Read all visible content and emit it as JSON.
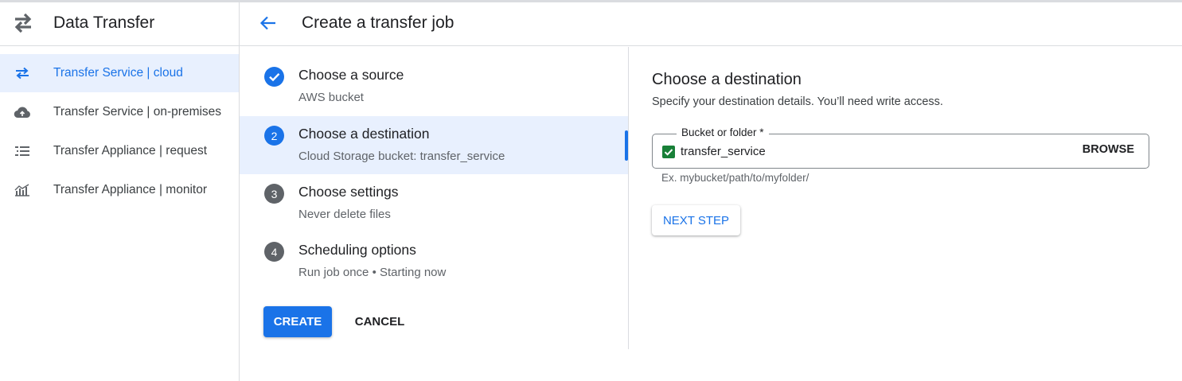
{
  "app": {
    "title": "Data Transfer"
  },
  "sidebar": {
    "items": [
      {
        "label": "Transfer Service | cloud",
        "icon": "swap-arrows-icon",
        "active": true
      },
      {
        "label": "Transfer Service | on-premises",
        "icon": "cloud-upload-icon"
      },
      {
        "label": "Transfer Appliance | request",
        "icon": "list-icon"
      },
      {
        "label": "Transfer Appliance | monitor",
        "icon": "monitoring-chart-icon"
      }
    ]
  },
  "header": {
    "title": "Create a transfer job",
    "back_icon": "arrow-back-icon"
  },
  "steps": [
    {
      "number": "1",
      "title": "Choose a source",
      "subtitle": "AWS bucket",
      "state": "complete"
    },
    {
      "number": "2",
      "title": "Choose a destination",
      "subtitle": "Cloud Storage bucket: transfer_service",
      "state": "active"
    },
    {
      "number": "3",
      "title": "Choose settings",
      "subtitle": "Never delete files",
      "state": "pending"
    },
    {
      "number": "4",
      "title": "Scheduling options",
      "subtitle": "Run job once • Starting now",
      "state": "pending"
    }
  ],
  "actions": {
    "create_label": "CREATE",
    "cancel_label": "CANCEL"
  },
  "destination": {
    "title": "Choose a destination",
    "description": "Specify your destination details. You’ll need write access.",
    "field_label": "Bucket or folder *",
    "field_value": "transfer_service",
    "browse_label": "BROWSE",
    "hint": "Ex. mybucket/path/to/myfolder/",
    "next_label": "NEXT STEP"
  },
  "colors": {
    "accent": "#1a73e8",
    "active_bg": "#e8f0fe",
    "success": "#188038"
  }
}
